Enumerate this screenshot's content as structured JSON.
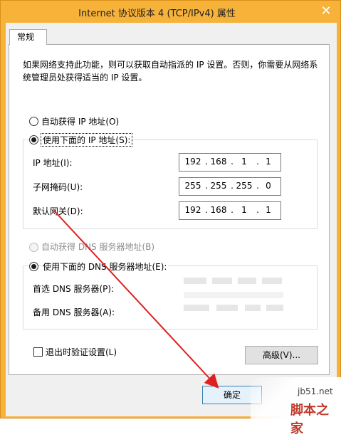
{
  "window": {
    "title": "Internet 协议版本 4 (TCP/IPv4) 属性",
    "close_glyph": "✕"
  },
  "tabs": [
    {
      "label": "常规"
    }
  ],
  "description": "如果网络支持此功能，则可以获取自动指派的 IP 设置。否则，你需要从网络系统管理员处获得适当的 IP 设置。",
  "ip_section": {
    "auto_label": "自动获得 IP 地址(O)",
    "manual_label": "使用下面的 IP 地址(S):",
    "selected": "manual",
    "fields": [
      {
        "label": "IP 地址(I):",
        "octets": [
          "192",
          "168",
          "1",
          "1"
        ]
      },
      {
        "label": "子网掩码(U):",
        "octets": [
          "255",
          "255",
          "255",
          "0"
        ]
      },
      {
        "label": "默认网关(D):",
        "octets": [
          "192",
          "168",
          "1",
          "1"
        ]
      }
    ]
  },
  "dns_section": {
    "auto_label": "自动获得 DNS 服务器地址(B)",
    "manual_label": "使用下面的 DNS 服务器地址(E):",
    "selected": "manual",
    "auto_disabled": true,
    "fields": [
      {
        "label": "首选 DNS 服务器(P):"
      },
      {
        "label": "备用 DNS 服务器(A):"
      }
    ]
  },
  "validate_on_exit": {
    "label": "退出时验证设置(L)",
    "checked": false
  },
  "buttons": {
    "advanced": "高级(V)...",
    "ok": "确定"
  },
  "watermark": {
    "site": "jb51.net",
    "brand": "脚本之家"
  },
  "colors": {
    "title_bar": "#f7b23a",
    "annotation_arrow": "#e02020"
  }
}
